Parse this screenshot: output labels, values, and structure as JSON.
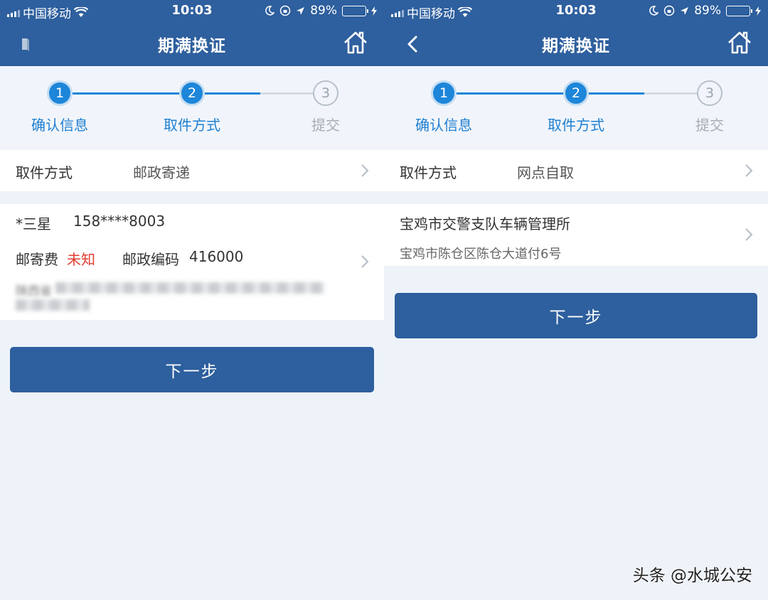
{
  "status": {
    "carrier": "中国移动",
    "time": "10:03",
    "battery": "89%",
    "battery_level": 0.89
  },
  "nav": {
    "title": "期满换证"
  },
  "steps": [
    {
      "number": "1",
      "label": "确认信息",
      "state": "active"
    },
    {
      "number": "2",
      "label": "取件方式",
      "state": "active"
    },
    {
      "number": "3",
      "label": "提交",
      "state": "pending"
    }
  ],
  "left": {
    "method_label": "取件方式",
    "method_value": "邮政寄递",
    "recipient_name": "*三星",
    "recipient_phone": "158****8003",
    "postage_label": "邮寄费",
    "postage_value": "未知",
    "postcode_label": "邮政编码",
    "postcode_value": "416000",
    "address_line1": "陕西省",
    "next_button": "下一步"
  },
  "right": {
    "method_label": "取件方式",
    "method_value": "网点自取",
    "station_name": "宝鸡市交警支队车辆管理所",
    "station_address": "宝鸡市陈仓区陈仓大道付6号",
    "next_button": "下一步"
  },
  "watermark": "头条 @水城公安",
  "colors": {
    "header": "#2e5f9e",
    "step_active": "#1d86d9",
    "postage_red": "#e03c31",
    "battery_green": "#4cd964"
  }
}
